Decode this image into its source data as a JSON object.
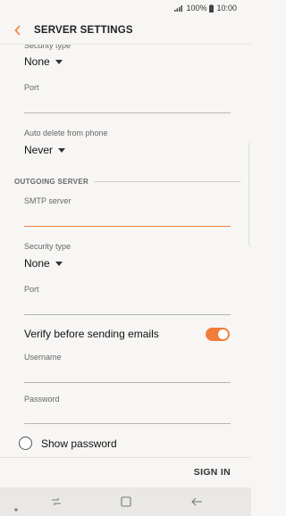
{
  "status": {
    "battery": "100%",
    "time": "10:00"
  },
  "header": {
    "title": "SERVER SETTINGS"
  },
  "incoming": {
    "security_label": "Security type",
    "security_value": "None",
    "port_label": "Port",
    "auto_delete_label": "Auto delete from phone",
    "auto_delete_value": "Never"
  },
  "outgoing": {
    "section_title": "OUTGOING SERVER",
    "smtp_label": "SMTP server",
    "security_label": "Security type",
    "security_value": "None",
    "port_label": "Port",
    "verify_label": "Verify before sending emails",
    "verify_on": true,
    "username_label": "Username",
    "password_label": "Password",
    "show_password_label": "Show password"
  },
  "footer": {
    "sign_in_label": "SIGN IN"
  },
  "colors": {
    "accent": "#f07e3a",
    "background": "#f7f6f4"
  }
}
